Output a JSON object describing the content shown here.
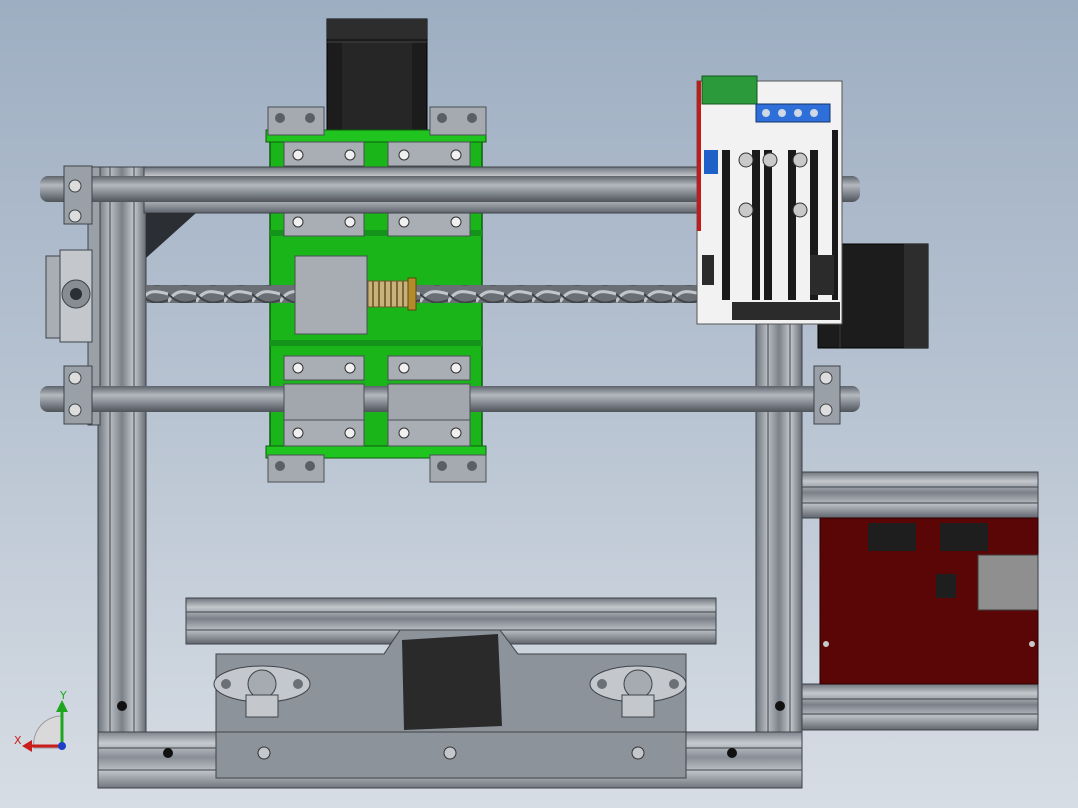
{
  "viewport": {
    "background_top": "#9eaec2",
    "background_bottom": "#d7dde4"
  },
  "colors": {
    "frame_metal": "#8d939b",
    "frame_dark": "#4a4f56",
    "carriage_green": "#19b519",
    "stepper_black": "#1c1c1c",
    "controller_board": "#f2f2f2",
    "driver_board": "#5a0606"
  },
  "triad": {
    "x_label": "X",
    "y_label": "Y",
    "x_color": "#cc1d1d",
    "y_color": "#1fa61f",
    "z_color": "#1c3fc9"
  },
  "icons": {
    "triad": "coordinate-triad-icon"
  }
}
